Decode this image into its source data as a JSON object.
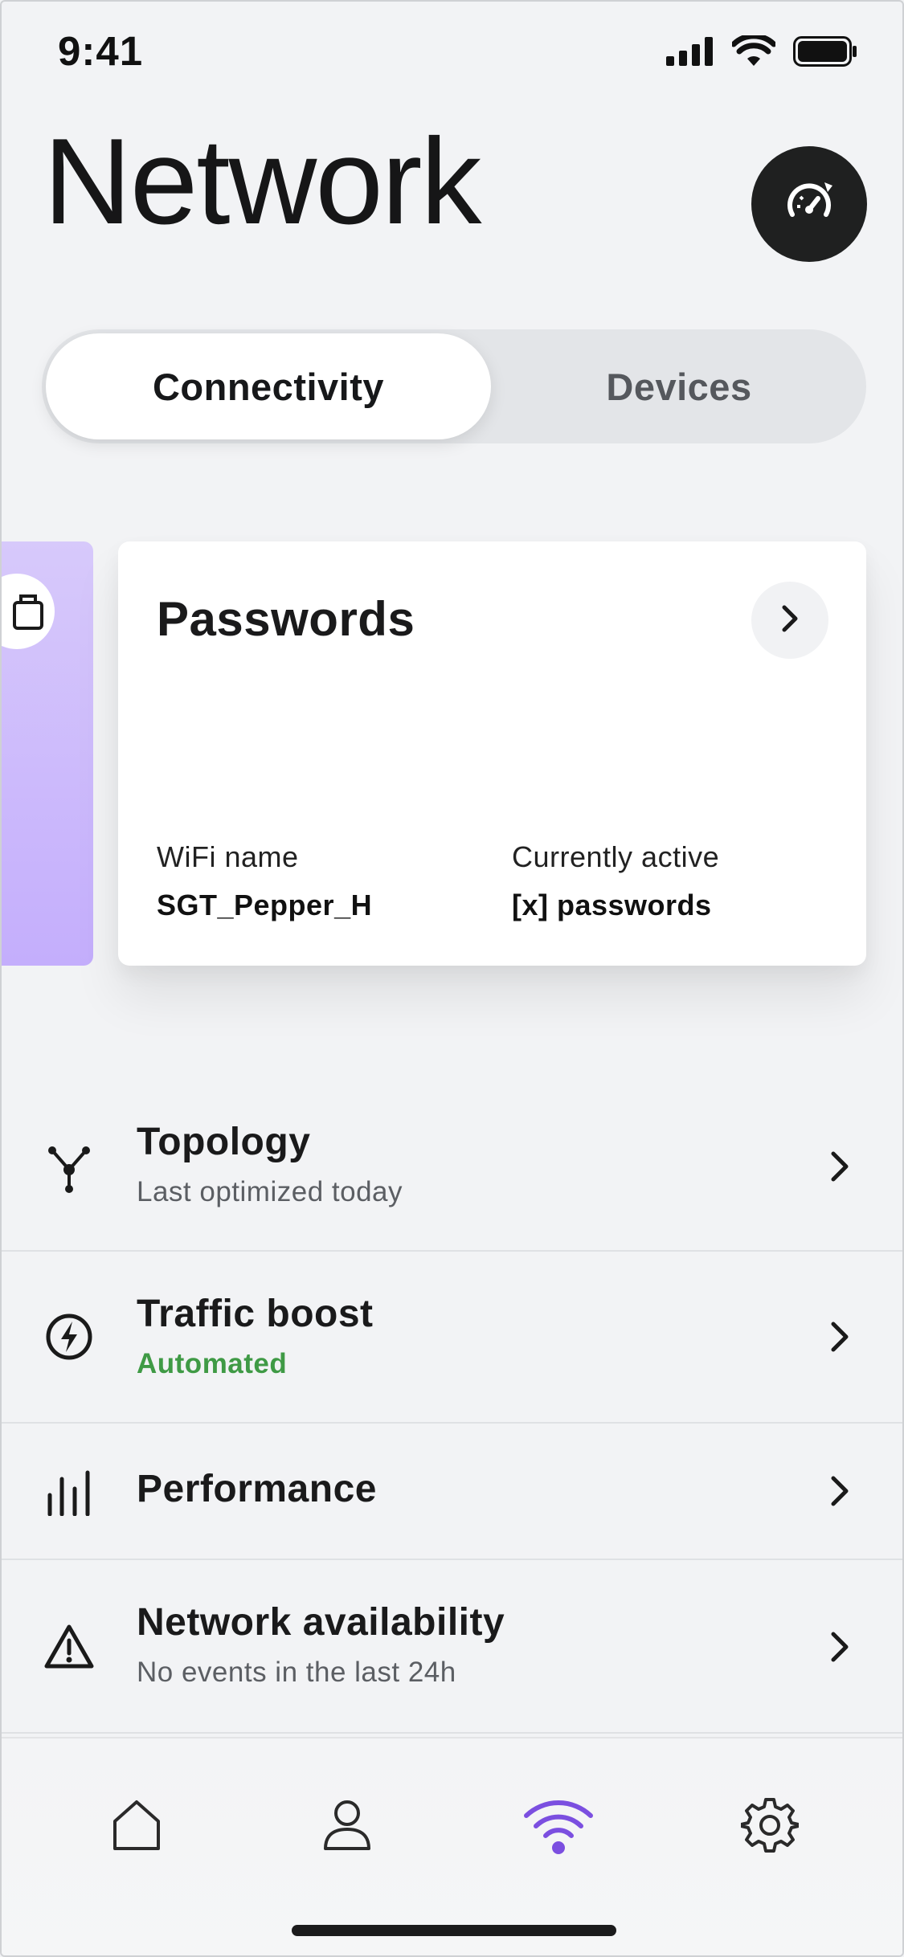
{
  "status_bar": {
    "time": "9:41",
    "icons": [
      "signal-icon",
      "wifi-icon",
      "battery-icon"
    ]
  },
  "header": {
    "title": "Network",
    "speed_button_icon": "speedometer-icon"
  },
  "segmented_control": {
    "tabs": [
      {
        "label": "Connectivity",
        "active": true
      },
      {
        "label": "Devices",
        "active": false
      }
    ]
  },
  "carousel": {
    "peek_card": {
      "icon": "devices-icon",
      "color": "#c9b6fb"
    },
    "passwords_card": {
      "title": "Passwords",
      "arrow_icon": "chevron-right-icon",
      "wifi_label": "WiFi name",
      "wifi_value": "SGT_Pepper_H",
      "active_label": "Currently active",
      "active_value": "[x] passwords"
    }
  },
  "list": [
    {
      "icon": "topology-icon",
      "title": "Topology",
      "subtitle": "Last optimized today"
    },
    {
      "icon": "lightning-icon",
      "title": "Traffic boost",
      "subtitle": "Automated",
      "subtitle_color": "#3f9a45"
    },
    {
      "icon": "bar-chart-icon",
      "title": "Performance",
      "subtitle": ""
    },
    {
      "icon": "warning-icon",
      "title": "Network availability",
      "subtitle": "No events in the last 24h"
    }
  ],
  "tab_bar": {
    "items": [
      {
        "icon": "home-icon",
        "active": false
      },
      {
        "icon": "profile-icon",
        "active": false
      },
      {
        "icon": "wifi-icon",
        "active": true
      },
      {
        "icon": "settings-icon",
        "active": false
      }
    ],
    "active_color": "#7b4fe0"
  }
}
